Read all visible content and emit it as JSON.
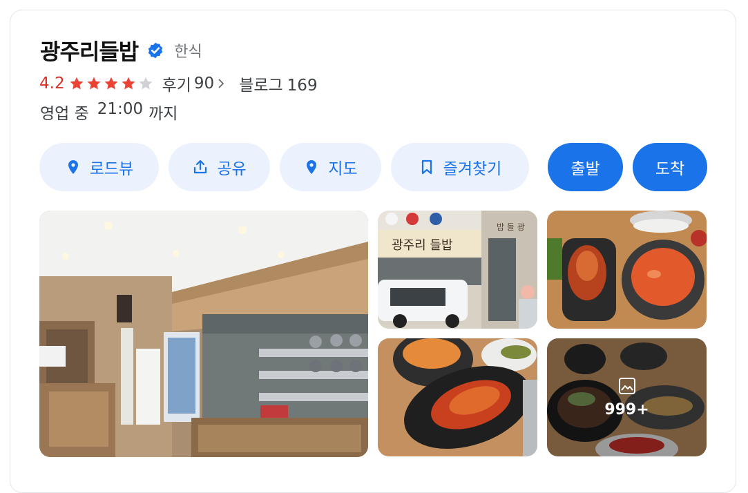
{
  "place": {
    "name": "광주리들밥",
    "category": "한식",
    "rating": "4.2",
    "stars": 4.2,
    "reviews_label": "후기",
    "reviews_count": "90",
    "blog_label": "블로그",
    "blog_count": "169",
    "status": "영업 중",
    "close_time": "21:00",
    "until": "까지"
  },
  "actions": {
    "roadview": "로드뷰",
    "share": "공유",
    "map": "지도",
    "favorite": "즐겨찾기",
    "depart": "출발",
    "arrive": "도착"
  },
  "photos": {
    "more_count": "999+",
    "sign_text": "광주리 들밥",
    "sign_side": "밥 들 광"
  },
  "colors": {
    "accent": "#1a73e8",
    "pill_bg": "#ebf1fd",
    "rating": "#d93025",
    "verified": "#1a73e8"
  }
}
